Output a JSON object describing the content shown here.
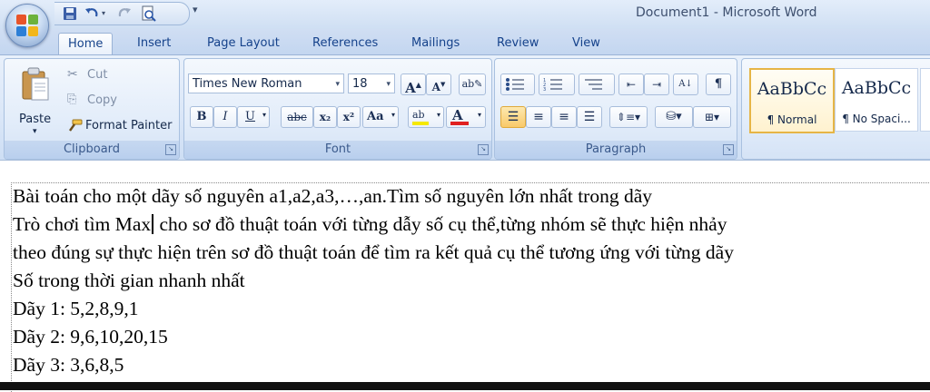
{
  "window": {
    "title": "Document1 - Microsoft Word"
  },
  "tabs": [
    "Home",
    "Insert",
    "Page Layout",
    "References",
    "Mailings",
    "Review",
    "View"
  ],
  "active_tab": "Home",
  "clipboard": {
    "label": "Clipboard",
    "paste": "Paste",
    "cut": "Cut",
    "copy": "Copy",
    "format_painter": "Format Painter"
  },
  "font": {
    "label": "Font",
    "font_name": "Times New Roman",
    "font_size": "18",
    "bold": "B",
    "italic": "I",
    "underline": "U",
    "strikethrough": "abc",
    "subscript": "x₂",
    "superscript": "x²",
    "change_case": "Aa",
    "highlight": "ab",
    "color": "A"
  },
  "paragraph": {
    "label": "Paragraph"
  },
  "styles": [
    {
      "sample": "AaBbCc",
      "name": "¶ Normal"
    },
    {
      "sample": "AaBbCc",
      "name": "¶ No Spaci..."
    }
  ],
  "colors": {
    "accent": "#15428b",
    "highlight": "#f5e800",
    "font_color": "#e02020",
    "selected_border": "#e6b546"
  },
  "document": {
    "lines": [
      "Bài toán cho một dãy số nguyên a1,a2,a3,…,an.Tìm số nguyên lớn nhất trong dãy",
      "Trò chơi tìm Max",
      " cho sơ đồ thuật toán với từng dẫy số cụ thể,từng nhóm sẽ thực hiện nhảy",
      "theo đúng sự thực hiện trên sơ đồ thuật toán để tìm ra kết quả cụ thể tương ứng với từng dãy",
      "Số trong thời gian nhanh nhất",
      "Dãy 1: 5,2,8,9,1",
      "Dãy 2: 9,6,10,20,15",
      "Dãy 3: 3,6,8,5"
    ]
  }
}
